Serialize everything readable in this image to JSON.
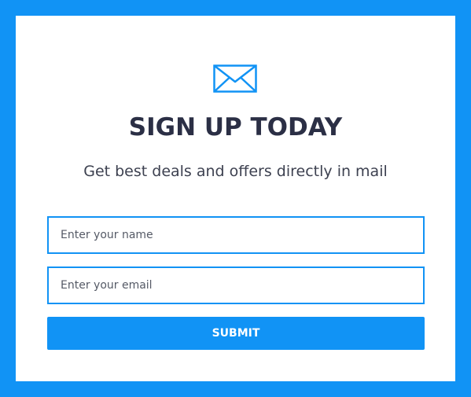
{
  "signup": {
    "icon": "envelope-icon",
    "title": "SIGN UP TODAY",
    "subtitle": "Get best deals and offers directly in mail",
    "name_placeholder": "Enter your name",
    "email_placeholder": "Enter your email",
    "submit_label": "SUBMIT"
  },
  "colors": {
    "accent": "#1193f5",
    "title": "#2b2f45",
    "background": "#ffffff"
  }
}
